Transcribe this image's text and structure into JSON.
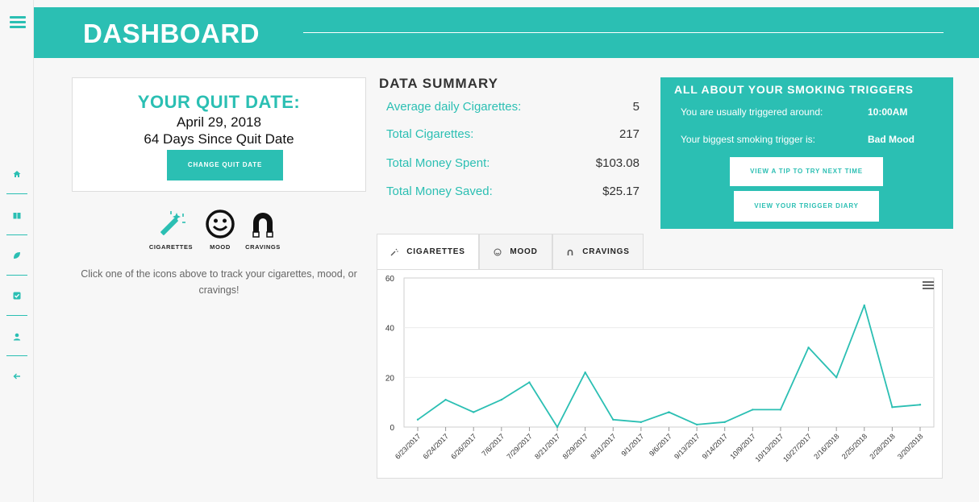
{
  "header": {
    "title": "DASHBOARD"
  },
  "sidebar": {
    "items": [
      {
        "name": "home-icon"
      },
      {
        "name": "book-icon"
      },
      {
        "name": "leaf-icon"
      },
      {
        "name": "checkbox-icon"
      },
      {
        "name": "user-icon"
      },
      {
        "name": "back-arrow-icon"
      }
    ]
  },
  "quit": {
    "title": "YOUR QUIT DATE:",
    "date": "April 29, 2018",
    "days_since": "64 Days Since Quit Date",
    "change_button": "CHANGE QUIT DATE"
  },
  "trackers": {
    "cigarettes": "CIGARETTES",
    "mood": "MOOD",
    "cravings": "CRAVINGS",
    "hint": "Click one of the icons above to track your cigarettes, mood, or cravings!"
  },
  "summary": {
    "title": "DATA SUMMARY",
    "rows": [
      {
        "label": "Average daily Cigarettes:",
        "value": "5"
      },
      {
        "label": "Total Cigarettes:",
        "value": "217"
      },
      {
        "label": "Total Money Spent:",
        "value": "$103.08"
      },
      {
        "label": "Total Money Saved:",
        "value": "$25.17"
      }
    ]
  },
  "triggers": {
    "title": "ALL ABOUT YOUR SMOKING TRIGGERS",
    "time_label": "You are usually triggered around:",
    "time_value": "10:00AM",
    "trigger_label": "Your biggest smoking trigger is:",
    "trigger_value": "Bad Mood",
    "tip_button": "VIEW A TIP TO TRY NEXT TIME",
    "diary_button": "VIEW YOUR TRIGGER DIARY"
  },
  "tabs": [
    {
      "label": "CIGARETTES",
      "icon": "wand-icon"
    },
    {
      "label": "MOOD",
      "icon": "smiley-icon"
    },
    {
      "label": "CRAVINGS",
      "icon": "magnet-icon"
    }
  ],
  "accent_color": "#2bbfb3",
  "chart_data": {
    "type": "line",
    "categories": [
      "6/23/2017",
      "6/24/2017",
      "6/26/2017",
      "7/6/2017",
      "7/29/2017",
      "8/21/2017",
      "8/29/2017",
      "8/31/2017",
      "9/1/2017",
      "9/6/2017",
      "9/13/2017",
      "9/14/2017",
      "10/9/2017",
      "10/13/2017",
      "10/27/2017",
      "2/16/2018",
      "2/25/2018",
      "2/28/2018",
      "3/20/2018"
    ],
    "series": [
      {
        "values": [
          3,
          11,
          6,
          11,
          18,
          0,
          22,
          3,
          2,
          6,
          1,
          2,
          7,
          7,
          32,
          20,
          49,
          8,
          9
        ]
      }
    ],
    "ylim": [
      0,
      60
    ],
    "yticks": [
      0,
      20,
      40,
      60
    ],
    "grid": true,
    "color": "#2bbfb3"
  }
}
